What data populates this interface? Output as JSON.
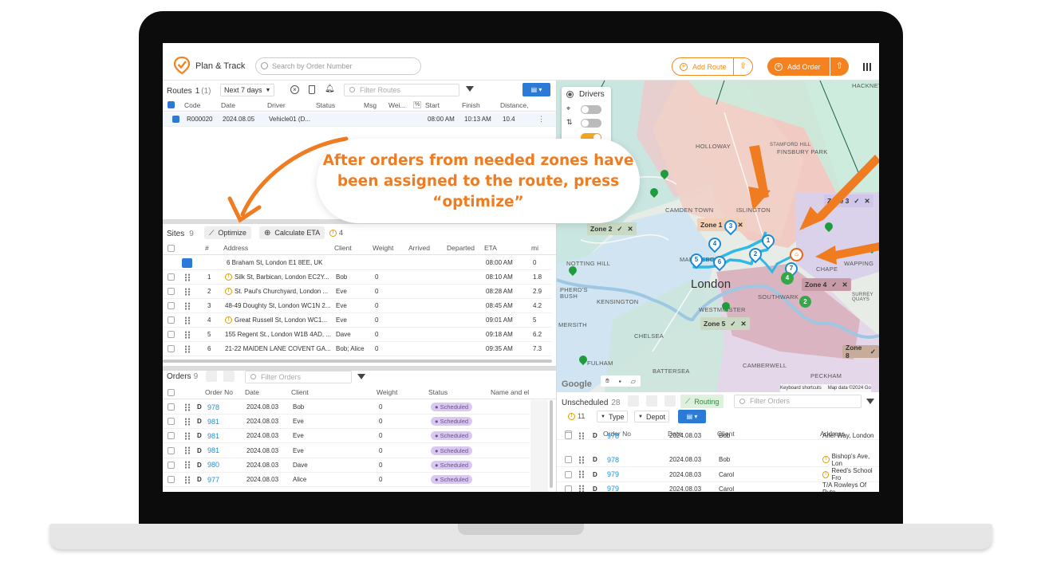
{
  "header": {
    "title": "Plan & Track",
    "search_placeholder": "Search by Order Number",
    "add_route": "Add Route",
    "add_order": "Add Order"
  },
  "routes": {
    "title": "Routes",
    "count": "1",
    "count_sel": "(1)",
    "range": "Next 7 days",
    "filter_placeholder": "Filter Routes",
    "columns": [
      "Code",
      "Date",
      "Driver",
      "Status",
      "Msg",
      "Wei...",
      "%",
      "Start",
      "Finish",
      "Distance,"
    ],
    "row": {
      "code": "R000020",
      "date": "2024.08.05",
      "driver": "Vehicle01 (D...",
      "start": "08:00 AM",
      "finish": "10:13 AM",
      "distance": "10.4"
    }
  },
  "sites": {
    "title": "Sites",
    "count": "9",
    "optimize": "Optimize",
    "calc_eta": "Calculate ETA",
    "warn_count": "4",
    "columns": [
      "#",
      "Address",
      "Client",
      "Weight",
      "Arrived",
      "Departed",
      "ETA",
      "mi"
    ],
    "depot": {
      "address": "6 Braham St, London E1 8EE, UK",
      "eta": "08:00 AM",
      "mi": "0"
    },
    "rows": [
      {
        "n": "1",
        "warn": true,
        "address": "Silk St, Barbican, London EC2Y...",
        "client": "Bob",
        "weight": "0",
        "eta": "08:10 AM",
        "mi": "1.8"
      },
      {
        "n": "2",
        "warn": true,
        "address": "St. Paul's Churchyard, London ...",
        "client": "Eve",
        "weight": "0",
        "eta": "08:28 AM",
        "mi": "2.9"
      },
      {
        "n": "3",
        "warn": false,
        "address": "48-49 Doughty St, London WC1N 2...",
        "client": "Eve",
        "weight": "0",
        "eta": "08:45 AM",
        "mi": "4.2"
      },
      {
        "n": "4",
        "warn": true,
        "address": "Great Russell St, London WC1...",
        "client": "Eve",
        "weight": "0",
        "eta": "09:01 AM",
        "mi": "5"
      },
      {
        "n": "5",
        "warn": false,
        "address": "155 Regent St., London W1B 4AD, ...",
        "client": "Dave",
        "weight": "0",
        "eta": "09:18 AM",
        "mi": "6.2"
      },
      {
        "n": "6",
        "warn": false,
        "address": "21-22 MAIDEN LANE COVENT GA...",
        "client": "Bob; Alice",
        "weight": "0",
        "eta": "09:35 AM",
        "mi": "7.3"
      }
    ]
  },
  "orders": {
    "title": "Orders",
    "count": "9",
    "filter_placeholder": "Filter Orders",
    "columns": [
      "Order No",
      "Date",
      "Client",
      "Weight",
      "Status",
      "Name and el"
    ],
    "rows": [
      {
        "type": "D",
        "no": "978",
        "date": "2024.08.03",
        "client": "Bob",
        "weight": "0",
        "status": "Scheduled"
      },
      {
        "type": "D",
        "no": "981",
        "date": "2024.08.03",
        "client": "Eve",
        "weight": "0",
        "status": "Scheduled"
      },
      {
        "type": "D",
        "no": "981",
        "date": "2024.08.03",
        "client": "Eve",
        "weight": "0",
        "status": "Scheduled"
      },
      {
        "type": "D",
        "no": "981",
        "date": "2024.08.03",
        "client": "Eve",
        "weight": "0",
        "status": "Scheduled"
      },
      {
        "type": "D",
        "no": "980",
        "date": "2024.08.03",
        "client": "Dave",
        "weight": "0",
        "status": "Scheduled"
      },
      {
        "type": "D",
        "no": "977",
        "date": "2024.08.03",
        "client": "Alice",
        "weight": "0",
        "status": "Scheduled"
      }
    ]
  },
  "map": {
    "drivers": "Drivers",
    "place_labels": [
      "HACKNEY",
      "STAMFORD HILL",
      "FINSBURY PARK",
      "HOLLOWAY",
      "CAMDEN TOWN",
      "ISLINGTON",
      "NOTTING HILL",
      "MARYLEBONE",
      "London",
      "KENSINGTON",
      "WESTMINSTER",
      "SOUTHWARK",
      "CHELSEA",
      "BATTERSEA",
      "CAMBERWELL",
      "PECKHAM",
      "MERSITH",
      "FULHAM",
      "PHERD'S",
      "BUSH",
      "SURREY QUAYS",
      "WAPPING",
      "CHAPE"
    ],
    "zones": [
      "Zone 1",
      "Zone 2",
      "Zone 3",
      "Zone 4",
      "Zone 5",
      "Zone 8"
    ],
    "footer": [
      "Keyboard shortcuts",
      "Map data ©2024 Go"
    ],
    "google": "Google"
  },
  "unscheduled": {
    "title": "Unscheduled",
    "count": "28",
    "routing": "Routing",
    "filter_placeholder": "Filter Orders",
    "warn_count": "11",
    "type": "Type",
    "depot": "Depot",
    "columns": [
      "Order No",
      "Date",
      "Client",
      "Address"
    ],
    "rows": [
      {
        "type": "D",
        "no": "978",
        "date": "2024.08.03",
        "client": "Bob",
        "address": "Arlel Way, London"
      },
      {
        "type": "D",
        "no": "978",
        "date": "2024.08.03",
        "client": "Bob",
        "address": "Bishop's Ave, Lon",
        "warn": true
      },
      {
        "type": "D",
        "no": "979",
        "date": "2024.08.03",
        "client": "Carol",
        "address": "Reed's School Fro",
        "warn": true
      },
      {
        "type": "D",
        "no": "979",
        "date": "2024.08.03",
        "client": "Carol",
        "address": "T/A Rowleys Of Putn"
      }
    ]
  },
  "callout": {
    "line1": "After orders from needed zones have",
    "line2": "been assigned to the route, press",
    "line3": "“optimize”"
  },
  "colors": {
    "accent": "#F58220",
    "blue": "#2B7BD6",
    "route": "#2FB8E6"
  }
}
